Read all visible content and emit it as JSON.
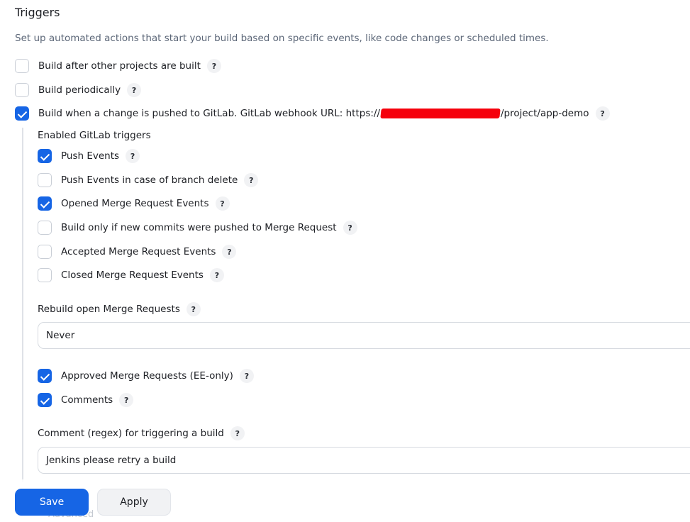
{
  "section": {
    "title": "Triggers",
    "description": "Set up automated actions that start your build based on specific events, like code changes or scheduled times."
  },
  "triggers": [
    {
      "label": "Build after other projects are built",
      "checked": false
    },
    {
      "label": "Build periodically",
      "checked": false
    },
    {
      "label_prefix": "Build when a change is pushed to GitLab. GitLab webhook URL: https://",
      "label_suffix": "/project/app-demo",
      "checked": true
    }
  ],
  "gitlab": {
    "enabled_label": "Enabled GitLab triggers",
    "events": [
      {
        "label": "Push Events",
        "checked": true
      },
      {
        "label": "Push Events in case of branch delete",
        "checked": false
      },
      {
        "label": "Opened Merge Request Events",
        "checked": true
      },
      {
        "label": "Build only if new commits were pushed to Merge Request",
        "checked": false
      },
      {
        "label": "Accepted Merge Request Events",
        "checked": false
      },
      {
        "label": "Closed Merge Request Events",
        "checked": false
      }
    ],
    "rebuild_label": "Rebuild open Merge Requests",
    "rebuild_value": "Never",
    "extra": [
      {
        "label": "Approved Merge Requests (EE-only)",
        "checked": true
      },
      {
        "label": "Comments",
        "checked": true
      }
    ],
    "comment_label": "Comment (regex) for triggering a build",
    "comment_value": "Jenkins please retry a build",
    "advanced_label": "Advanced"
  },
  "help_glyph": "?",
  "buttons": {
    "save": "Save",
    "apply": "Apply"
  },
  "colors": {
    "accent": "#1665e5",
    "redaction": "#f5000c"
  }
}
